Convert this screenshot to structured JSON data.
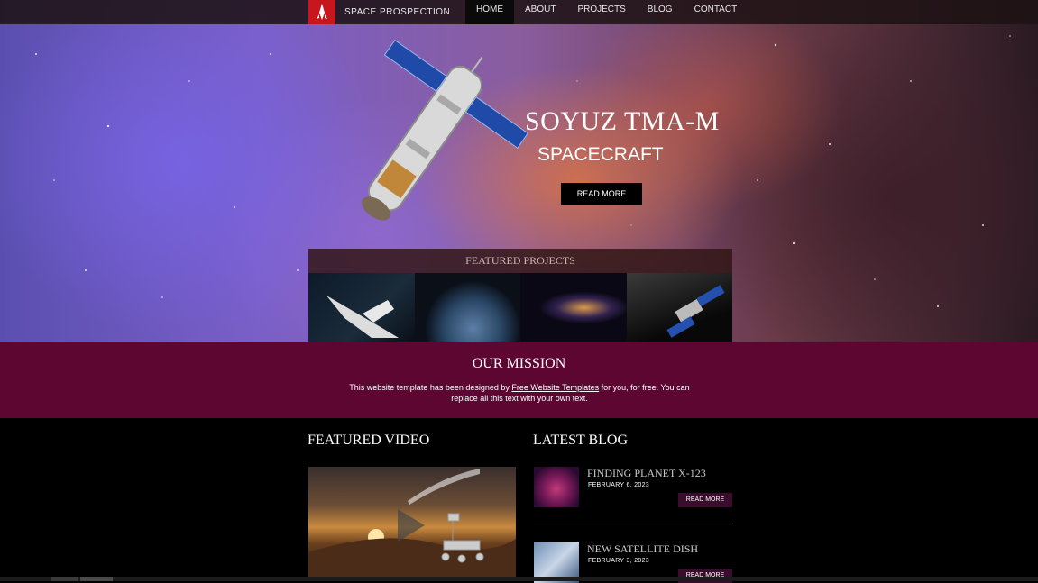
{
  "brand": {
    "name": "SPACE PROSPECTION"
  },
  "nav": {
    "items": [
      "HOME",
      "ABOUT",
      "PROJECTS",
      "BLOG",
      "CONTACT"
    ],
    "active": "HOME"
  },
  "hero": {
    "title": "SOYUZ TMA-M",
    "subtitle": "SPACECRAFT",
    "button": "READ MORE"
  },
  "featured_projects": {
    "heading": "FEATURED PROJECTS"
  },
  "mission": {
    "title": "OUR MISSION",
    "text_before": "This website template has been designed by ",
    "link": "Free Website Templates",
    "text_after": " for you, for free. You can replace all this text with your own text."
  },
  "featured_video": {
    "heading": "FEATURED VIDEO"
  },
  "latest_blog": {
    "heading": "LATEST BLOG",
    "posts": [
      {
        "title": "FINDING PLANET X-123",
        "date": "FEBRUARY 6, 2023",
        "button": "READ MORE"
      },
      {
        "title": "NEW SATELLITE DISH",
        "date": "FEBRUARY 3, 2023",
        "button": "READ MORE"
      }
    ]
  },
  "colors": {
    "accent": "#c8161e",
    "mission_bg": "#5e0632",
    "blog_button": "#3a0d2c"
  }
}
